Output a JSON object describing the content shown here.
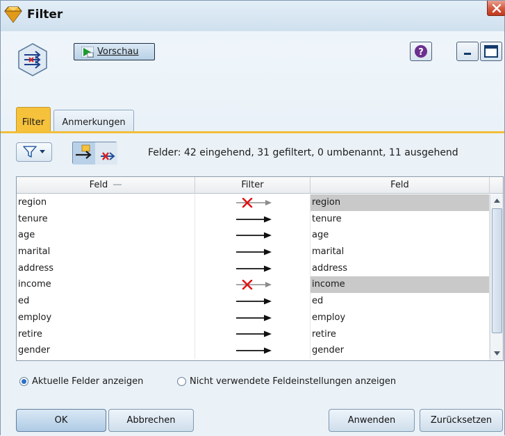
{
  "window": {
    "title": "Filter",
    "accent_color": "#f6c23c"
  },
  "toolbar": {
    "preview_label": "Vorschau",
    "icons": [
      "filter-node-icon",
      "preview-icon",
      "help-icon",
      "minimize-icon",
      "maximize-icon",
      "close-icon"
    ]
  },
  "tabs": [
    {
      "label": "Filter",
      "active": true
    },
    {
      "label": "Anmerkungen",
      "active": false
    }
  ],
  "filter_toolbar": {
    "summary": "Felder: 42 eingehend, 31 gefiltert, 0 umbenannt, 11 ausgehend"
  },
  "table": {
    "headers": [
      "Feld",
      "Filter",
      "Feld"
    ],
    "rows": [
      {
        "field": "region",
        "filtered": true,
        "output": "region"
      },
      {
        "field": "tenure",
        "filtered": false,
        "output": "tenure"
      },
      {
        "field": "age",
        "filtered": false,
        "output": "age"
      },
      {
        "field": "marital",
        "filtered": false,
        "output": "marital"
      },
      {
        "field": "address",
        "filtered": false,
        "output": "address"
      },
      {
        "field": "income",
        "filtered": true,
        "output": "income"
      },
      {
        "field": "ed",
        "filtered": false,
        "output": "ed"
      },
      {
        "field": "employ",
        "filtered": false,
        "output": "employ"
      },
      {
        "field": "retire",
        "filtered": false,
        "output": "retire"
      },
      {
        "field": "gender",
        "filtered": false,
        "output": "gender"
      }
    ]
  },
  "view_options": {
    "current_fields": {
      "label": "Aktuelle Felder anzeigen",
      "selected": true
    },
    "unused_settings": {
      "label": "Nicht verwendete Feldeinstellungen anzeigen",
      "selected": false
    }
  },
  "buttons": {
    "ok": "OK",
    "cancel": "Abbrechen",
    "apply": "Anwenden",
    "reset": "Zurücksetzen"
  }
}
